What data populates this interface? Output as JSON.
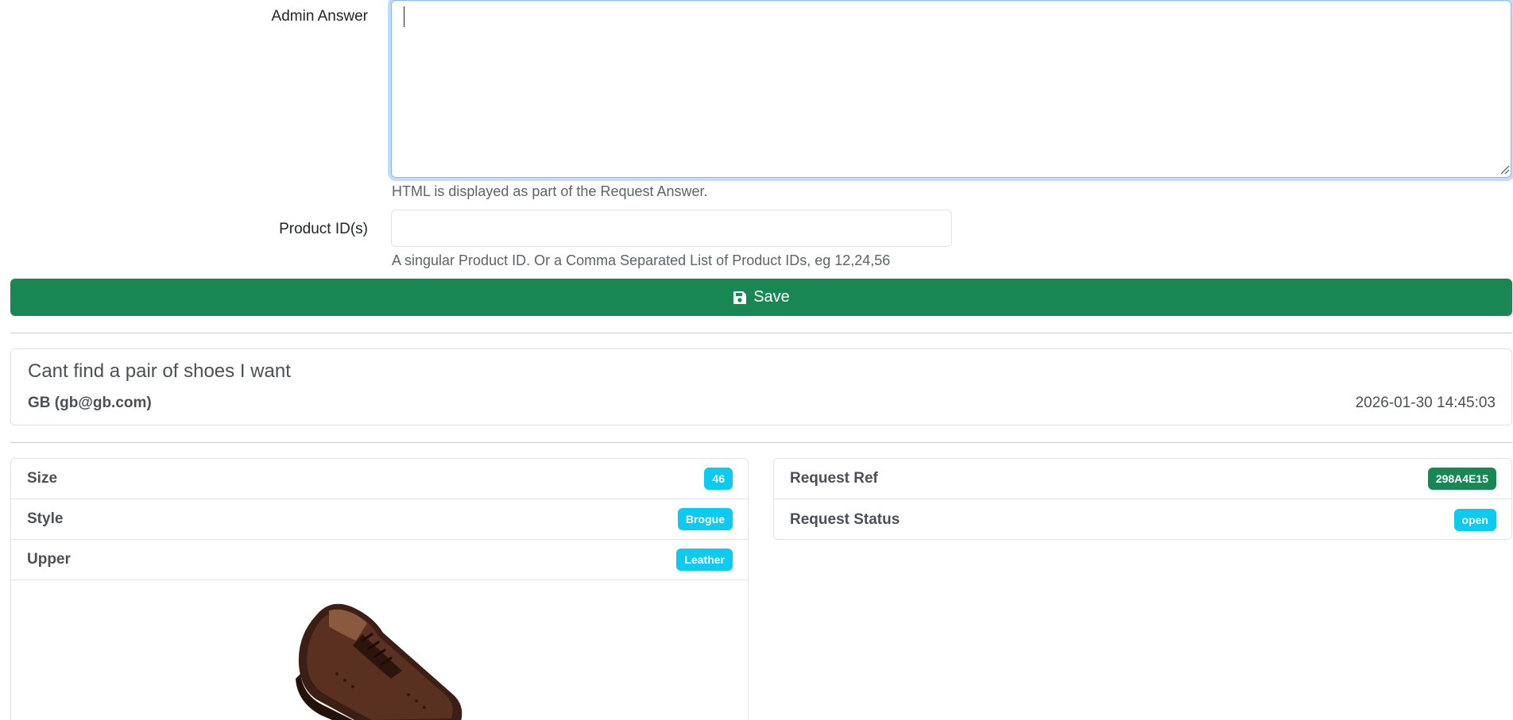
{
  "form": {
    "answer_label": "Admin Answer",
    "answer_value": "",
    "answer_help": "HTML is displayed as part of the Request Answer.",
    "product_label": "Product ID(s)",
    "product_value": "",
    "product_help": "A singular Product ID. Or a Comma Separated List of Product IDs, eg 12,24,56",
    "save_label": "Save",
    "save_icon": "floppy-disk-icon"
  },
  "request": {
    "title": "Cant find a pair of shoes I want",
    "user": "GB (gb@gb.com)",
    "date": "2026-01-30 14:45:03"
  },
  "attributes": [
    {
      "label": "Size",
      "value": "46"
    },
    {
      "label": "Style",
      "value": "Brogue"
    },
    {
      "label": "Upper",
      "value": "Leather"
    }
  ],
  "meta": [
    {
      "label": "Request Ref",
      "value": "298A4E15"
    },
    {
      "label": "Request Status",
      "value": "open"
    }
  ],
  "colors": {
    "success": "#198754",
    "info": "#0dcaf0",
    "focus_border": "#86b7fe"
  }
}
